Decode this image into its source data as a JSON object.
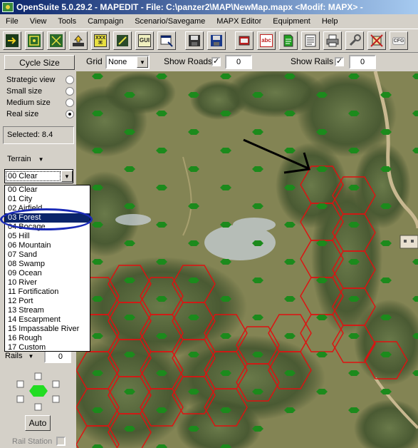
{
  "window": {
    "title": "OpenSuite   5.0.29.2 - MAPEDIT - File: C:\\panzer2\\MAP\\NewMap.mapx <Modif: MAPX>  -"
  },
  "menu": [
    "File",
    "View",
    "Tools",
    "Campaign",
    "Scenario/Savegame",
    "MAPX Editor",
    "Equipment",
    "Help"
  ],
  "toolbar": {
    "icons": [
      "exit-icon",
      "grid-icon",
      "grid-icon",
      "upload-icon",
      "xxx-icon",
      "frame-icon",
      "gui-icon",
      "window-icon",
      "save-icon",
      "save-as-icon",
      "unit-icon",
      "abc-icon",
      "document-icon",
      "notes-icon",
      "print-icon",
      "tool-icon",
      "crossed-icon",
      "cfg-icon"
    ],
    "gui_label": "GUI",
    "xxx_label": "XXX",
    "abc_label": "abc",
    "cfg_label": "CFG"
  },
  "options": {
    "cycle_size": "Cycle Size",
    "grid_label": "Grid",
    "grid_value": "None",
    "show_roads_label": "Show Roads",
    "show_roads_checked": "✓",
    "show_roads_value": "0",
    "show_rails_label": "Show Rails",
    "show_rails_checked": "✓",
    "show_rails_value": "0"
  },
  "view_sizes": [
    {
      "label": "Strategic view",
      "selected": false
    },
    {
      "label": "Small size",
      "selected": false
    },
    {
      "label": "Medium size",
      "selected": false
    },
    {
      "label": "Real size",
      "selected": true
    }
  ],
  "selected_text": "Selected: 8.4",
  "terrain": {
    "label": "Terrain",
    "current": "00 Clear",
    "options": [
      "00 Clear",
      "01 City",
      "02 Airfield",
      "03 Forest",
      "04 Bocage",
      "05 Hill",
      "06 Mountain",
      "07 Sand",
      "08 Swamp",
      "09 Ocean",
      "10 River",
      "11 Fortification",
      "12 Port",
      "13 Stream",
      "14 Escarpment",
      "15 Impassable River",
      "16 Rough",
      "17 Custom"
    ],
    "selected_index": 3
  },
  "rails": {
    "label": "Rails",
    "value": "0"
  },
  "auto_label": "Auto",
  "rail_station_label": "Rail Station",
  "colors": {
    "title_start": "#0a246a",
    "title_end": "#a6caf0",
    "hex_outline": "#e01010",
    "hex_dot": "#1c8a1c",
    "highlight_circle": "#1a2ab8",
    "arrow": "#000000"
  }
}
